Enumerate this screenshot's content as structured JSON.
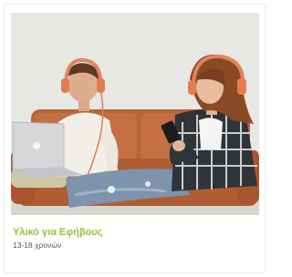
{
  "card": {
    "title": "Υλικό για Εφήβους",
    "subtitle": "13-18 χρονών",
    "title_color": "#8cc63f"
  },
  "image": {
    "icon": "teens-on-sofa-photo"
  }
}
